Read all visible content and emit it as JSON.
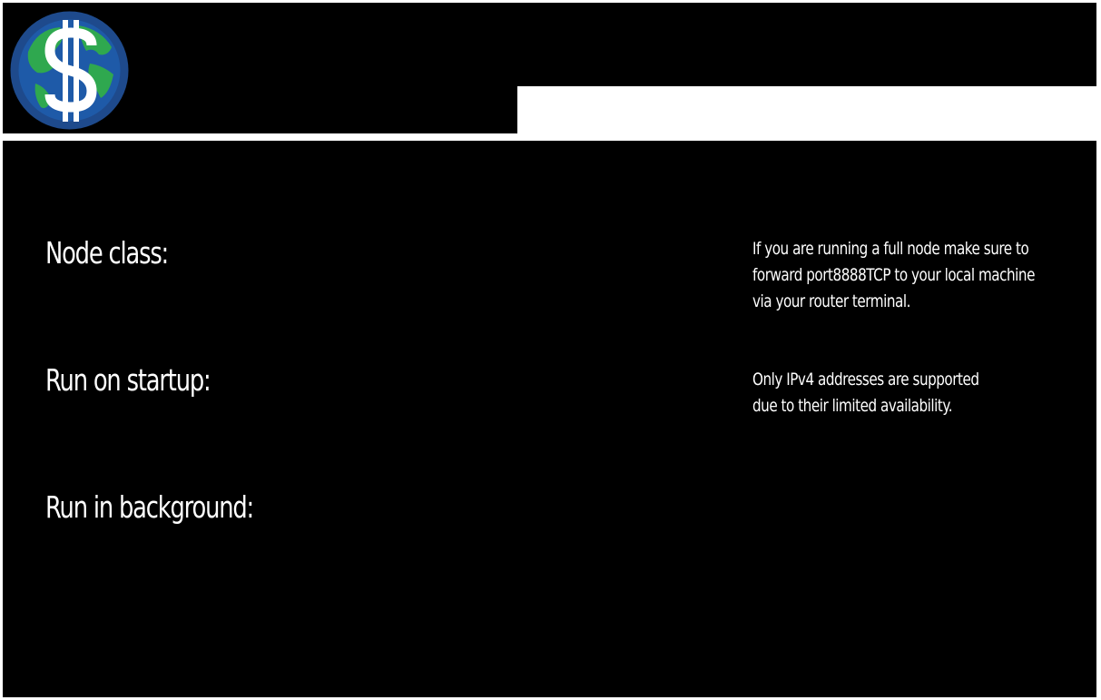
{
  "header": {
    "logo_icon": "globe-dollar-logo",
    "colors": {
      "background": "#000000",
      "panel": "#ffffff",
      "logo_ring": "#1e4a8c",
      "logo_land": "#2fa84f",
      "logo_symbol": "#ffffff"
    }
  },
  "settings": {
    "node_class_label": "Node class:",
    "run_on_startup_label": "Run on startup:",
    "run_in_background_label": "Run in background:"
  },
  "info": {
    "port_forward_lines": [
      "If you are running a full node make sure to",
      "forward port8888TCP to your local machine",
      "via your router terminal."
    ],
    "ipv4_lines": [
      "Only IPv4 addresses are supported",
      "due to their limited availability."
    ]
  }
}
